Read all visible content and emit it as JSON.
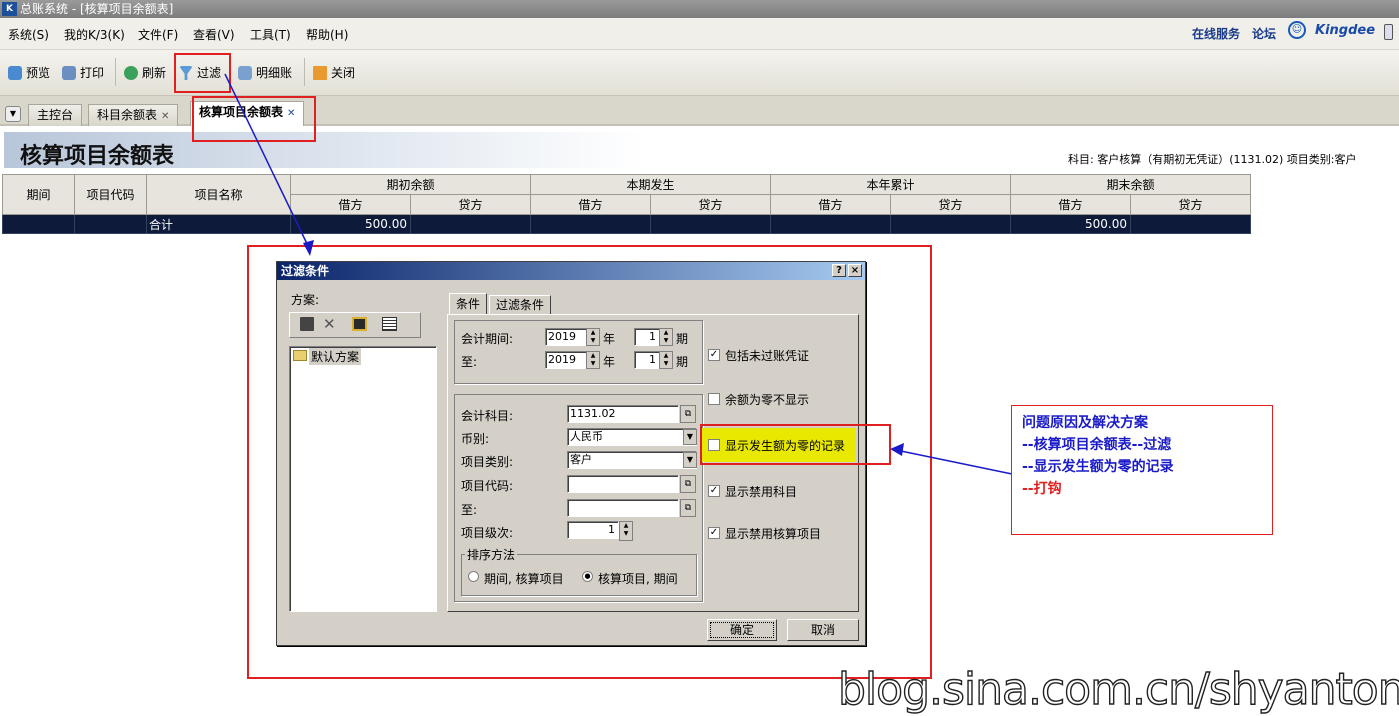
{
  "window": {
    "title": "总账系统 - [核算项目余额表]"
  },
  "menu": {
    "items": [
      "系统(S)",
      "我的K/3(K)",
      "文件(F)",
      "查看(V)",
      "工具(T)",
      "帮助(H)"
    ],
    "online_service": "在线服务",
    "forum": "论坛",
    "brand": "Kingdee"
  },
  "toolbar": {
    "preview": "预览",
    "print": "打印",
    "refresh": "刷新",
    "filter": "过滤",
    "detail": "明细账",
    "close": "关闭"
  },
  "tabs": [
    "主控台",
    "科目余额表",
    "核算项目余额表"
  ],
  "report": {
    "title": "核算项目余额表",
    "subject_info": "科目: 客户核算（有期初无凭证）(1131.02)  项目类别:客户",
    "columns": {
      "period": "期间",
      "item_code": "项目代码",
      "item_name": "项目名称",
      "opening": "期初余额",
      "current": "本期发生",
      "ytd": "本年累计",
      "closing": "期末余额",
      "debit": "借方",
      "credit": "贷方"
    },
    "total_row": {
      "label": "合计",
      "opening_debit": "500.00",
      "closing_debit": "500.00"
    }
  },
  "dialog": {
    "title": "过滤条件",
    "help": "?",
    "close": "×",
    "scheme_label": "方案:",
    "default_scheme": "默认方案",
    "tabs": [
      "条件",
      "过滤条件"
    ],
    "period_label": "会计期间:",
    "to_label": "至:",
    "year_from": "2019",
    "year_to": "2019",
    "period_from": "1",
    "period_to": "1",
    "year_unit": "年",
    "period_unit": "期",
    "account_label": "会计科目:",
    "account_value": "1131.02",
    "currency_label": "币别:",
    "currency_value": "人民币",
    "item_type_label": "项目类别:",
    "item_type_value": "客户",
    "item_code_label": "项目代码:",
    "item_to_label": "至:",
    "level_label": "项目级次:",
    "level_value": "1",
    "sort_label": "排序方法",
    "sort_opt1": "期间, 核算项目",
    "sort_opt2": "核算项目, 期间",
    "chk_unposted": "包括未过账凭证",
    "chk_zero_balance": "余额为零不显示",
    "chk_zero_amount": "显示发生额为零的记录",
    "chk_disabled_account": "显示禁用科目",
    "chk_disabled_item": "显示禁用核算项目",
    "ok": "确定",
    "cancel": "取消"
  },
  "note": {
    "line1": "问题原因及解决方案",
    "line2": "--核算项目余额表--过滤",
    "line3": "--显示发生额为零的记录",
    "line4": "--打钩"
  },
  "watermark": "blog.sina.com.cn/shyantong",
  "colors": {
    "highlight": "#e8e800",
    "annotation_red": "#e02020",
    "annotation_blue": "#1a1ac8",
    "total_row_bg": "#0d1a3a"
  }
}
